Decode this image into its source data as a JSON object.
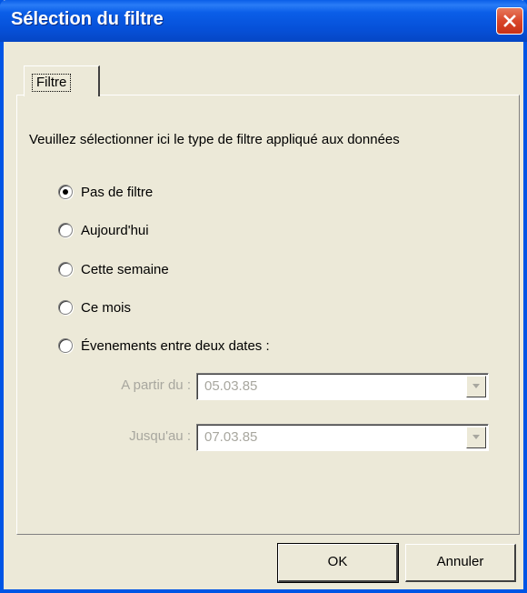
{
  "window": {
    "title": "Sélection du filtre"
  },
  "tabs": [
    {
      "label": "Filtre"
    }
  ],
  "instruction": "Veuillez sélectionner ici le type de filtre appliqué aux données",
  "filter_options": [
    {
      "label": "Pas de filtre",
      "checked": true
    },
    {
      "label": "Aujourd'hui",
      "checked": false
    },
    {
      "label": "Cette semaine",
      "checked": false
    },
    {
      "label": "Ce mois",
      "checked": false
    },
    {
      "label": "Évenements entre deux dates :",
      "checked": false
    }
  ],
  "date_range": {
    "from_label": "A partir du :",
    "from_value": "05.03.85",
    "to_label": "Jusqu'au :",
    "to_value": "07.03.85",
    "enabled": false
  },
  "buttons": {
    "ok": "OK",
    "cancel": "Annuler"
  },
  "icons": {
    "close": "close-icon",
    "dropdown": "chevron-down-icon"
  },
  "colors": {
    "titlebar": "#0a5ee8",
    "close_button": "#d9462a",
    "dialog_bg": "#ece9d8",
    "disabled_text": "#a8a79f"
  }
}
